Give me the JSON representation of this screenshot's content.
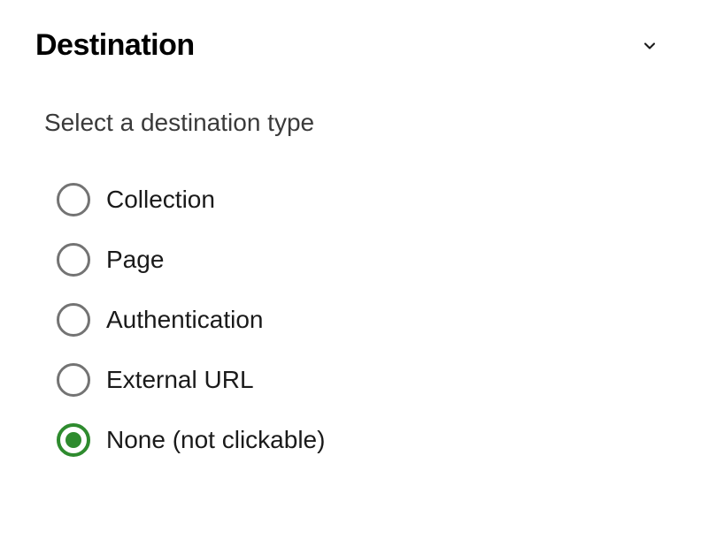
{
  "section": {
    "title": "Destination",
    "subtitle": "Select a destination type"
  },
  "options": [
    {
      "label": "Collection",
      "selected": false
    },
    {
      "label": "Page",
      "selected": false
    },
    {
      "label": "Authentication",
      "selected": false
    },
    {
      "label": "External URL",
      "selected": false
    },
    {
      "label": "None (not clickable)",
      "selected": true
    }
  ]
}
